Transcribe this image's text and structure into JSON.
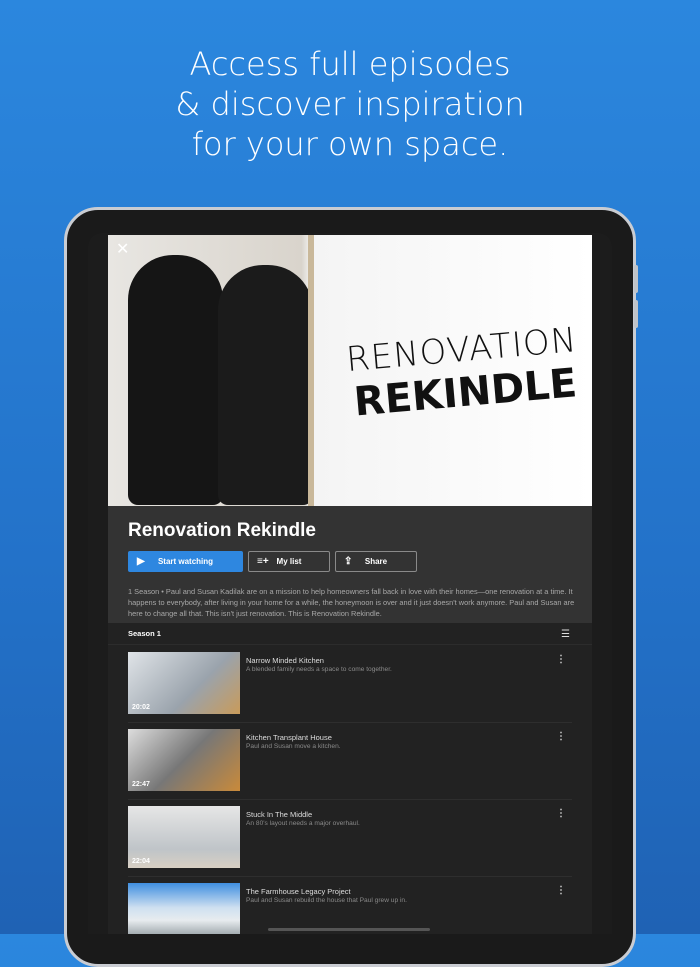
{
  "headline": [
    "Access full episodes",
    "& discover inspiration",
    "for your own space."
  ],
  "show": {
    "logo_line1": "RENOVATION",
    "logo_line2": "REKINDLE",
    "title": "Renovation Rekindle",
    "start_label": "Start watching",
    "mylist_label": "My list",
    "share_label": "Share",
    "description": "1 Season • Paul and Susan Kadilak are on a mission to help homeowners fall back in love with their homes—one renovation at a time. It happens to everybody, after living in your home for a while, the honeymoon is over and it just doesn't work anymore. Paul and Susan are here to change all that.  This isn't just renovation. This is Renovation Rekindle."
  },
  "season_label": "Season 1",
  "episodes": [
    {
      "title": "Narrow Minded Kitchen",
      "desc": "A blended family needs a space to come together.",
      "duration": "20:02"
    },
    {
      "title": "Kitchen Transplant House",
      "desc": "Paul and Susan move a kitchen.",
      "duration": "22:47"
    },
    {
      "title": "Stuck In The Middle",
      "desc": "An 80's layout needs a major overhaul.",
      "duration": "22:04"
    },
    {
      "title": "The Farmhouse Legacy Project",
      "desc": "Paul and Susan rebuild the house that Paul grew up in.",
      "duration": ""
    }
  ],
  "colors": {
    "accent": "#2e87e0",
    "background": "#2b87de"
  }
}
